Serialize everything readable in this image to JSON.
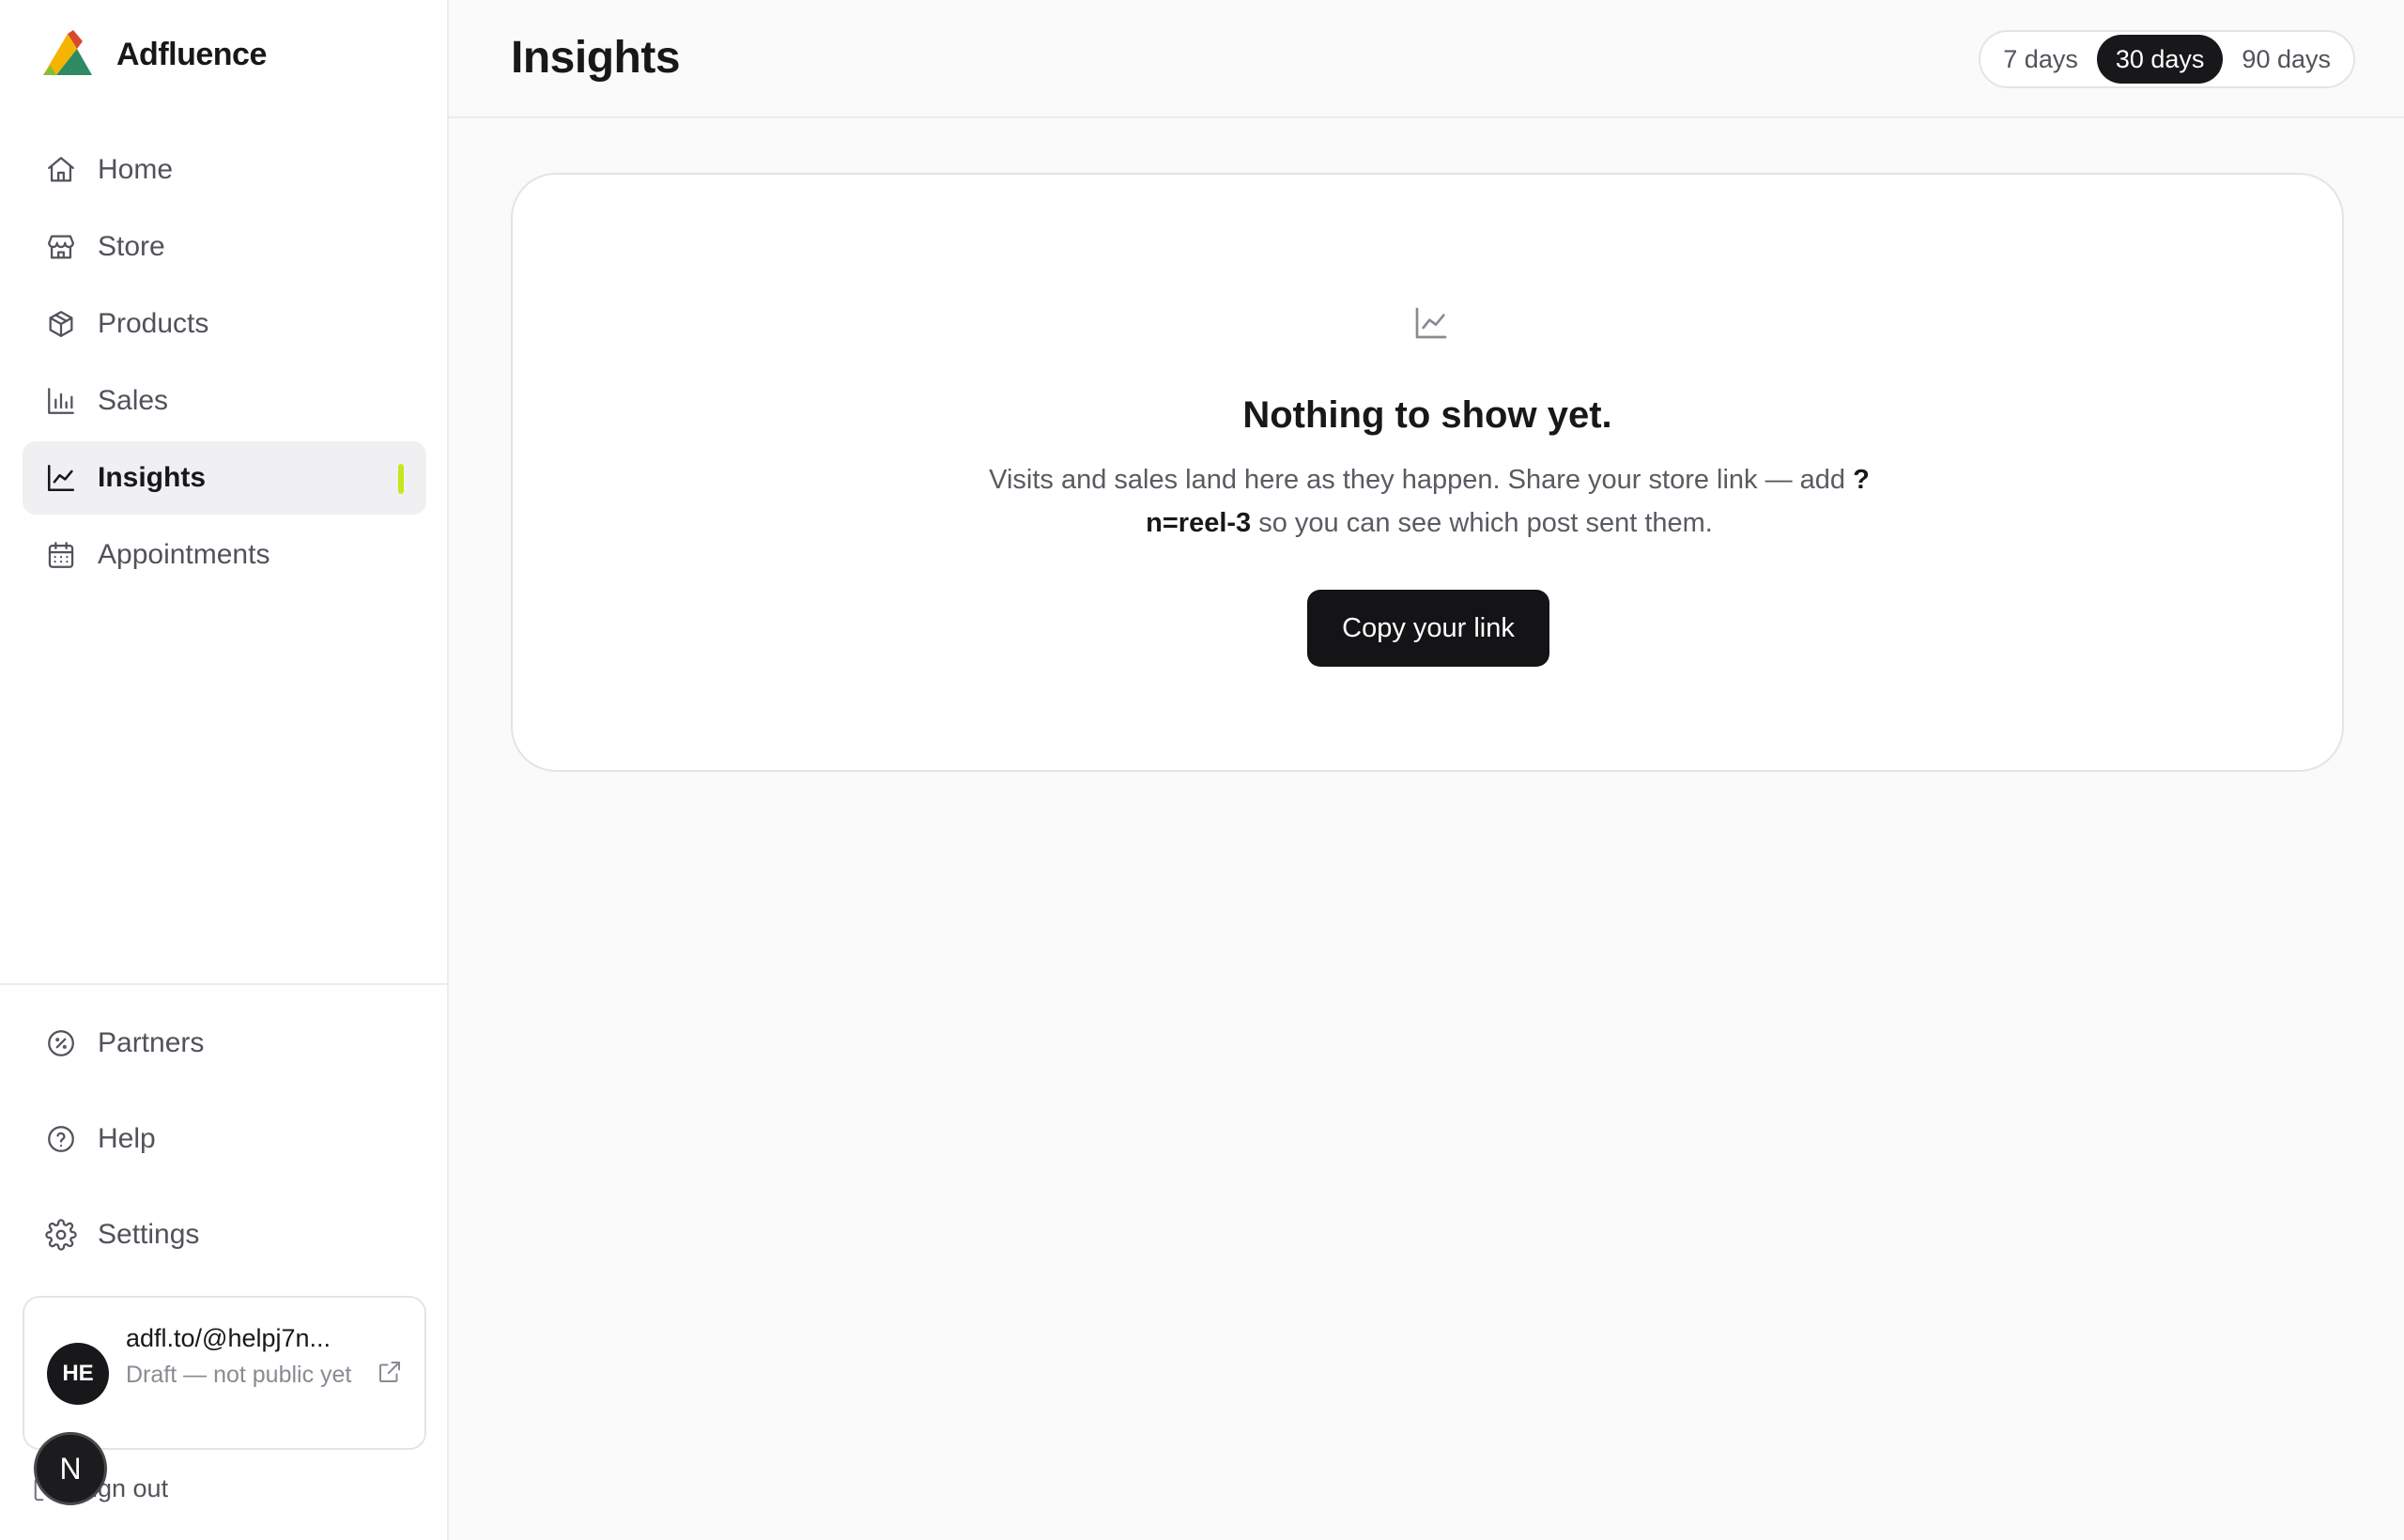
{
  "brand": {
    "name": "Adfluence",
    "logo_icon": "adfluence-logo"
  },
  "nav": {
    "items": [
      {
        "label": "Home",
        "icon": "home-icon"
      },
      {
        "label": "Store",
        "icon": "store-icon"
      },
      {
        "label": "Products",
        "icon": "box-icon"
      },
      {
        "label": "Sales",
        "icon": "bar-chart-icon"
      },
      {
        "label": "Insights",
        "icon": "line-chart-icon",
        "active": true
      },
      {
        "label": "Appointments",
        "icon": "calendar-icon"
      }
    ],
    "secondary": [
      {
        "label": "Partners",
        "icon": "badge-percent-icon"
      },
      {
        "label": "Help",
        "icon": "help-circle-icon"
      },
      {
        "label": "Settings",
        "icon": "gear-icon"
      }
    ],
    "active_accent": "#c4e81c"
  },
  "profile": {
    "initials": "HE",
    "url": "adfl.to/@helpj7n...",
    "status": "Draft — not public yet"
  },
  "signout": {
    "label": "Sign out"
  },
  "floating_badge": {
    "letter": "N"
  },
  "header": {
    "title": "Insights",
    "ranges": [
      "7 days",
      "30 days",
      "90 days"
    ],
    "selected_range": "30 days"
  },
  "empty_state": {
    "title": "Nothing to show yet.",
    "desc_part1": "Visits and sales land here as they happen. Share your store link — add ",
    "desc_code": "?n=reel-3",
    "desc_part2": " so you can see which post sent them.",
    "button": "Copy your link"
  }
}
